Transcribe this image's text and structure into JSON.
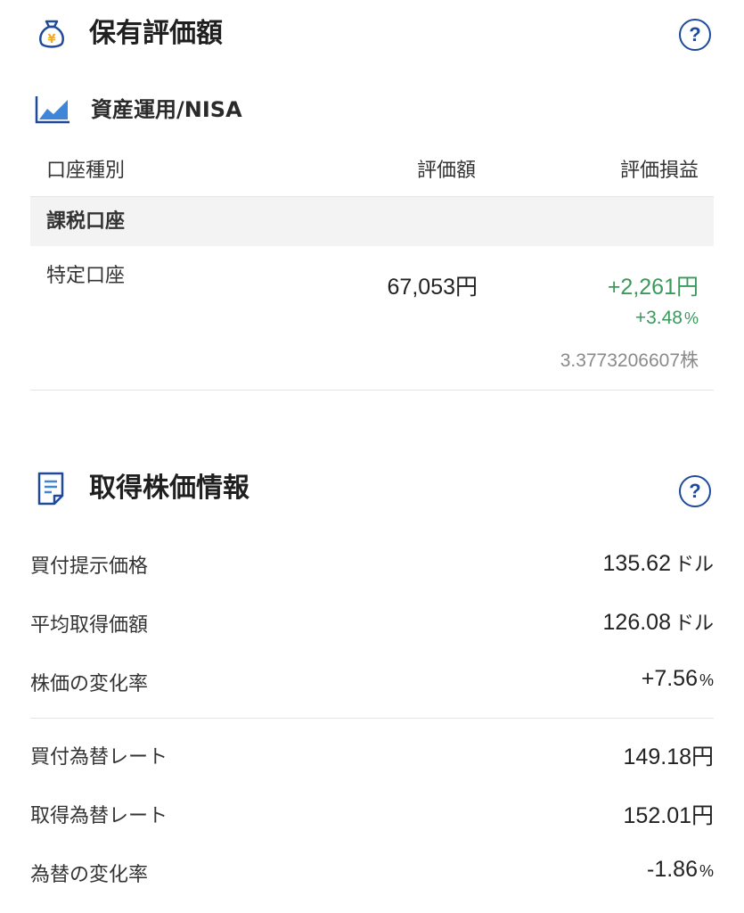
{
  "holdings": {
    "title": "保有評価額",
    "help_label": "?",
    "sub_title": "資産運用/NISA",
    "columns": [
      "口座種別",
      "評価額",
      "評価損益"
    ],
    "group_label": "課税口座",
    "account": {
      "name": "特定口座",
      "value": "67,053円",
      "pl_amount": "+2,261円",
      "pl_percent_num": "+3.48",
      "pl_percent_sign": "%",
      "shares": "3.3773206607株"
    }
  },
  "acquisition": {
    "title": "取得株価情報",
    "help_label": "?",
    "rows1": [
      {
        "label": "買付提示価格",
        "value": "135.62",
        "unit": "ドル"
      },
      {
        "label": "平均取得価額",
        "value": "126.08",
        "unit": "ドル"
      },
      {
        "label": "株価の変化率",
        "value": "+7.56",
        "unit": "%"
      }
    ],
    "rows2": [
      {
        "label": "買付為替レート",
        "value": "149.18円",
        "unit": ""
      },
      {
        "label": "取得為替レート",
        "value": "152.01円",
        "unit": ""
      },
      {
        "label": "為替の変化率",
        "value": "-1.86",
        "unit": "%"
      }
    ]
  },
  "colors": {
    "accent": "#1f4a9a",
    "positive": "#3a9a5c",
    "negative": "#e0526a"
  }
}
